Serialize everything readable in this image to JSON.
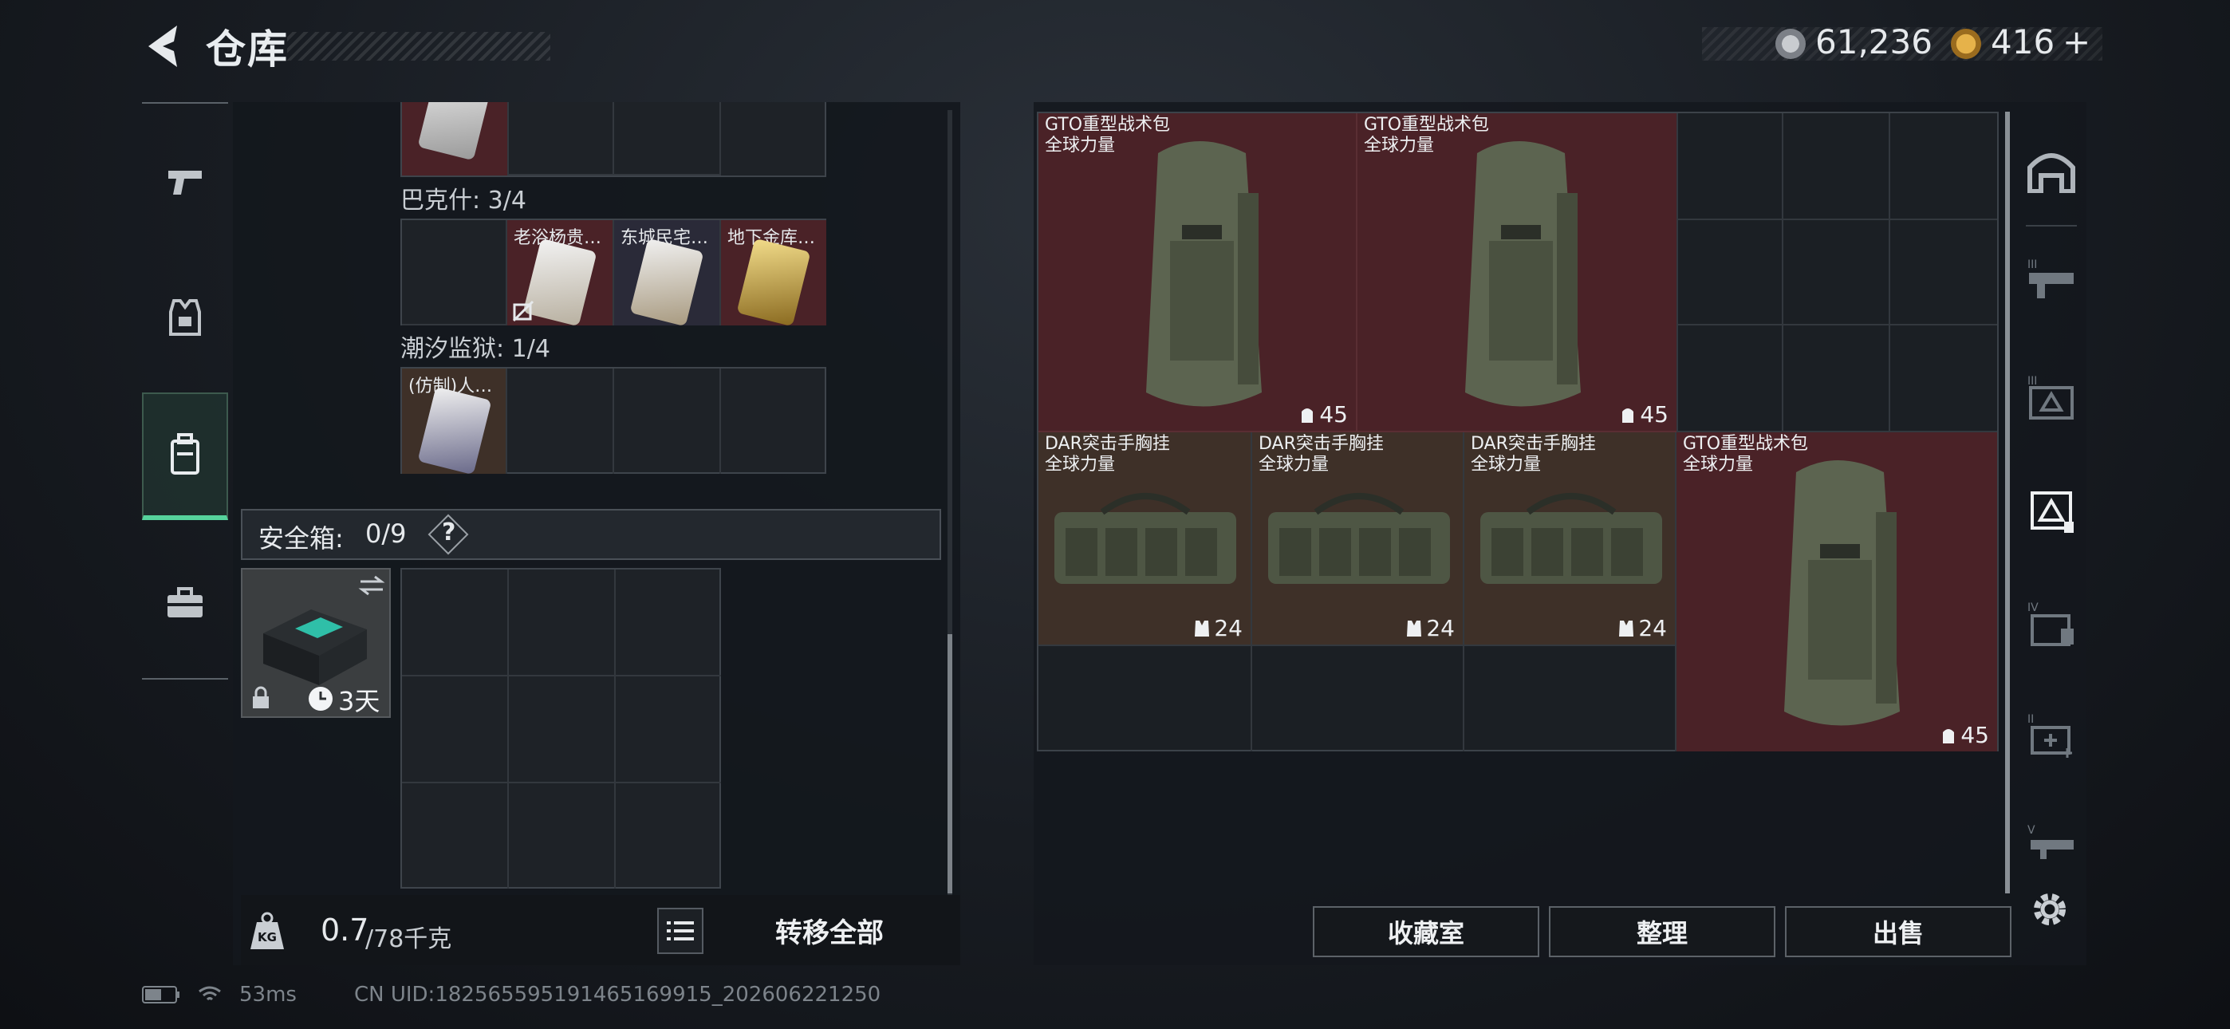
{
  "header": {
    "title": "仓库",
    "currency": [
      {
        "icon": "silver-coin-icon",
        "value": "61,236"
      },
      {
        "icon": "gold-triangle-coin-icon",
        "value": "416"
      }
    ],
    "add_symbol": "+"
  },
  "left_rail": [
    {
      "icon": "pistol-icon"
    },
    {
      "icon": "armor-vest-icon"
    },
    {
      "icon": "backpack-icon",
      "active": true
    },
    {
      "icon": "toolbox-icon"
    }
  ],
  "collection": {
    "sections": [
      {
        "label": "巴克什: 3/4",
        "items": [
          "",
          "老浴杨贵…",
          "东城民宅…",
          "地下金库…"
        ]
      },
      {
        "label": "潮汐监狱: 1/4",
        "items": [
          "(仿制)人…"
        ]
      }
    ]
  },
  "safe_box": {
    "label": "安全箱:",
    "count": "0/9",
    "help": "?",
    "timer": "3天"
  },
  "weight": {
    "current": "0.7",
    "max": "/78千克",
    "kg_label": "KG"
  },
  "transfer_all": "转移全部",
  "stash_items": [
    {
      "name": "GTO重型战术包",
      "sub": "全球力量",
      "count": "45",
      "kind": "backpack"
    },
    {
      "name": "GTO重型战术包",
      "sub": "全球力量",
      "count": "45",
      "kind": "backpack"
    },
    {
      "name": "DAR突击手胸挂",
      "sub": "全球力量",
      "count": "24",
      "kind": "rig"
    },
    {
      "name": "DAR突击手胸挂",
      "sub": "全球力量",
      "count": "24",
      "kind": "rig"
    },
    {
      "name": "DAR突击手胸挂",
      "sub": "全球力量",
      "count": "24",
      "kind": "rig"
    },
    {
      "name": "GTO重型战术包",
      "sub": "全球力量",
      "count": "45",
      "kind": "backpack"
    }
  ],
  "right_rail": [
    {
      "icon": "storage-arch-icon",
      "tier": ""
    },
    {
      "icon": "gun-rack-icon",
      "tier": "III"
    },
    {
      "icon": "gear-crate-icon",
      "tier": "III"
    },
    {
      "icon": "equipment-crate-icon",
      "tier": "",
      "active": true
    },
    {
      "icon": "supply-crate-icon",
      "tier": "IV"
    },
    {
      "icon": "medical-crate-icon",
      "tier": "II"
    },
    {
      "icon": "weapon-case-icon",
      "tier": "V"
    }
  ],
  "bottom_buttons": {
    "favorites": "收藏室",
    "sort": "整理",
    "sell": "出售"
  },
  "status": {
    "ping": "53ms",
    "uid": "CN UID:18256559519146516991​5_202606221250"
  },
  "colors": {
    "red_tile": "#4a2227",
    "brown_tile": "#3e3028",
    "accent_green": "#56d39c"
  }
}
